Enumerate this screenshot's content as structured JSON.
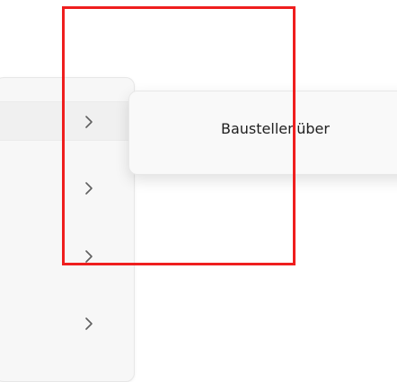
{
  "menu": {
    "items": [
      {
        "icon": "chevron-right-icon",
        "state": "selected"
      },
      {
        "icon": "chevron-right-icon",
        "state": "normal"
      },
      {
        "icon": "chevron-right-icon",
        "state": "normal"
      },
      {
        "icon": "chevron-right-icon",
        "state": "normal"
      }
    ]
  },
  "submenu": {
    "label": "Baustellenüber"
  },
  "annotation": {
    "color": "#ef1e1e"
  }
}
